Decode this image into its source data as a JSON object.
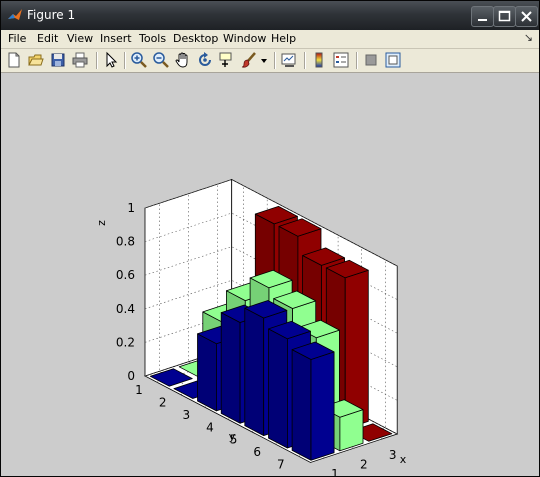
{
  "window": {
    "title": "Figure 1",
    "minimize_label": "minimize",
    "maximize_label": "maximize",
    "close_label": "close"
  },
  "menu": [
    "File",
    "Edit",
    "View",
    "Insert",
    "Tools",
    "Desktop",
    "Window",
    "Help"
  ],
  "toolbar": {
    "icons": [
      "new-figure-icon",
      "open-file-icon",
      "save-icon",
      "print-icon",
      "select-arrow-icon",
      "zoom-in-icon",
      "zoom-out-icon",
      "pan-hand-icon",
      "rotate-3d-icon",
      "data-cursor-icon",
      "brush-icon",
      "brush-dropdown-icon",
      "link-plot-icon",
      "colorbar-icon",
      "legend-icon",
      "hide-plot-tools-icon",
      "show-plot-tools-icon"
    ]
  },
  "chart_data": {
    "type": "bar3",
    "title": "",
    "xlabel": "x",
    "ylabel": "y",
    "zlabel": "z",
    "x_ticks": [
      "1",
      "2",
      "3"
    ],
    "y_ticks": [
      "1",
      "2",
      "3",
      "4",
      "5",
      "6",
      "7"
    ],
    "z_ticks": [
      "0",
      "0.2",
      "0.4",
      "0.6",
      "0.8",
      "1"
    ],
    "zlim": [
      0,
      1
    ],
    "grid": true,
    "colors": {
      "x1": "#000090",
      "x2": "#90ff90",
      "x3": "#900000"
    },
    "series": [
      {
        "x": 1,
        "values": [
          0,
          0,
          0.4,
          0.6,
          0.7,
          0.65,
          0.6
        ]
      },
      {
        "x": 2,
        "values": [
          0,
          0.4,
          0.6,
          0.75,
          0.7,
          0.6,
          0.2
        ]
      },
      {
        "x": 3,
        "values": [
          0,
          0,
          1,
          1,
          0.9,
          0.9,
          0
        ]
      }
    ]
  }
}
